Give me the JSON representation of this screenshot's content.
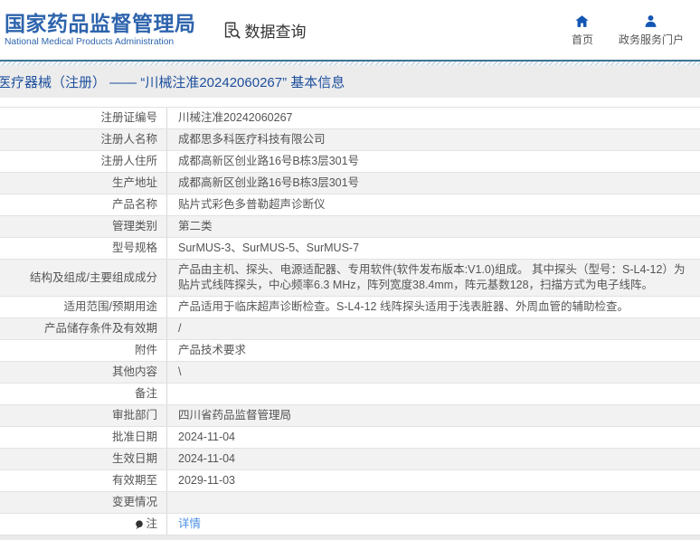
{
  "header": {
    "logo_title": "国家药品监督管理局",
    "logo_subtitle": "National Medical Products Administration",
    "data_query_label": "数据查询",
    "nav": [
      {
        "icon": "home-icon",
        "label": "首页"
      },
      {
        "icon": "user-icon",
        "label": "政务服务门户"
      }
    ]
  },
  "breadcrumb": {
    "text": "医疗器械（注册） —— “川械注准20242060267” 基本信息"
  },
  "table": {
    "rows": [
      {
        "label": "注册证编号",
        "value": "川械注准20242060267"
      },
      {
        "label": "注册人名称",
        "value": "成都思多科医疗科技有限公司"
      },
      {
        "label": "注册人住所",
        "value": "成都高新区创业路16号B栋3层301号"
      },
      {
        "label": "生产地址",
        "value": "成都高新区创业路16号B栋3层301号"
      },
      {
        "label": "产品名称",
        "value": "贴片式彩色多普勒超声诊断仪"
      },
      {
        "label": "管理类别",
        "value": "第二类"
      },
      {
        "label": "型号规格",
        "value": "SurMUS-3、SurMUS-5、SurMUS-7"
      },
      {
        "label": "结构及组成/主要组成成分",
        "value": "产品由主机、探头、电源适配器、专用软件(软件发布版本:V1.0)组成。 其中探头（型号：S-L4-12）为贴片式线阵探头，中心频率6.3 MHz，阵列宽度38.4mm，阵元基数128，扫描方式为电子线阵。"
      },
      {
        "label": "适用范围/预期用途",
        "value": "产品适用于临床超声诊断检查。S-L4-12 线阵探头适用于浅表脏器、外周血管的辅助检查。"
      },
      {
        "label": "产品储存条件及有效期",
        "value": "/"
      },
      {
        "label": "附件",
        "value": "产品技术要求"
      },
      {
        "label": "其他内容",
        "value": "\\"
      },
      {
        "label": "备注",
        "value": ""
      },
      {
        "label": "审批部门",
        "value": "四川省药品监督管理局"
      },
      {
        "label": "批准日期",
        "value": "2024-11-04"
      },
      {
        "label": "生效日期",
        "value": "2024-11-04"
      },
      {
        "label": "有效期至",
        "value": "2029-11-03"
      },
      {
        "label": "变更情况",
        "value": ""
      },
      {
        "label": "注",
        "value": "详情",
        "link": true,
        "label_icon": "note-icon"
      }
    ]
  },
  "colors": {
    "brand_blue": "#2e64ad",
    "nav_icon_blue": "#1356b4",
    "breadcrumb_text": "#1d4f9d",
    "breadcrumb_bg": "#ececec",
    "stripe_line": "#3d7492",
    "link_blue": "#4a90e2",
    "alt_row_bg": "#f2f2f2",
    "border": "#e2e2e2"
  }
}
